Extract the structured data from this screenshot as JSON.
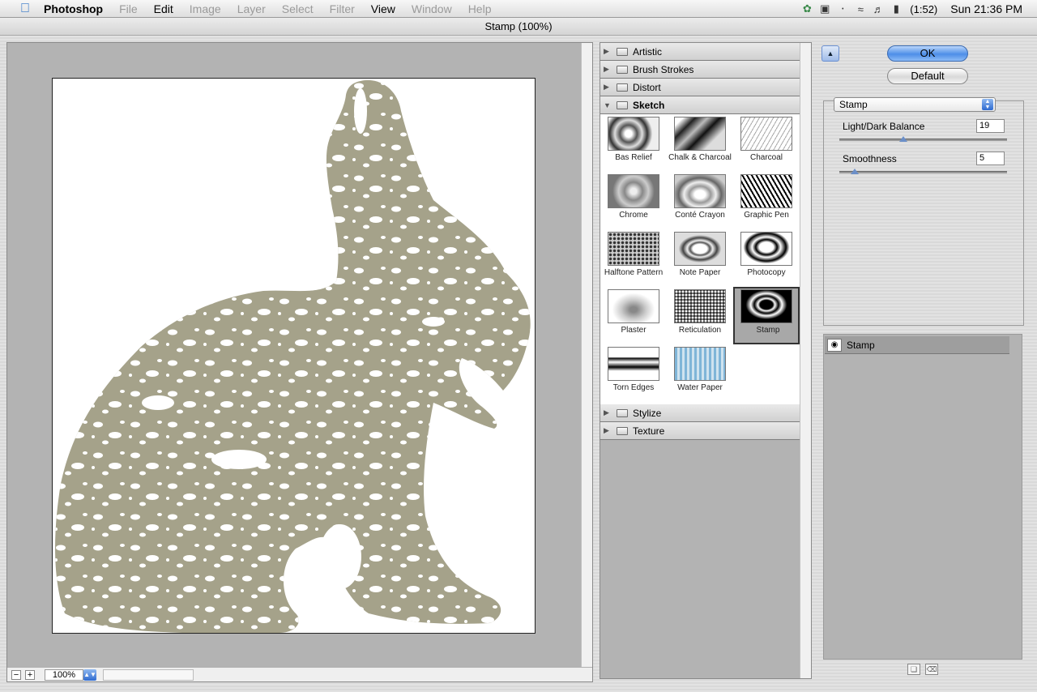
{
  "menubar": {
    "apple_icon": "apple-icon",
    "items": [
      {
        "label": "Photoshop",
        "disabled": false
      },
      {
        "label": "File",
        "disabled": true
      },
      {
        "label": "Edit",
        "disabled": false
      },
      {
        "label": "Image",
        "disabled": true
      },
      {
        "label": "Layer",
        "disabled": true
      },
      {
        "label": "Select",
        "disabled": true
      },
      {
        "label": "Filter",
        "disabled": true
      },
      {
        "label": "View",
        "disabled": false
      },
      {
        "label": "Window",
        "disabled": true
      },
      {
        "label": "Help",
        "disabled": true
      }
    ],
    "battery_text": "(1:52)",
    "clock": "Sun 21:36 PM"
  },
  "window": {
    "title": "Stamp (100%)"
  },
  "preview": {
    "zoom": "100%",
    "zoom_out": "−",
    "zoom_in": "+",
    "image_color": "#a5a28a"
  },
  "filter_gallery": {
    "categories_top": [
      "Artistic",
      "Brush Strokes",
      "Distort"
    ],
    "open_category": "Sketch",
    "thumbnails": [
      "Bas Relief",
      "Chalk & Charcoal",
      "Charcoal",
      "Chrome",
      "Conté Crayon",
      "Graphic Pen",
      "Halftone Pattern",
      "Note Paper",
      "Photocopy",
      "Plaster",
      "Reticulation",
      "Stamp",
      "Torn Edges",
      "Water Paper"
    ],
    "selected": "Stamp",
    "categories_bottom": [
      "Stylize",
      "Texture"
    ]
  },
  "controls": {
    "ok_label": "OK",
    "default_label": "Default",
    "filter_select": "Stamp",
    "param1_label": "Light/Dark Balance",
    "param1_value": "19",
    "param2_label": "Smoothness",
    "param2_value": "5"
  },
  "effect_layers": {
    "layer_name": "Stamp"
  }
}
